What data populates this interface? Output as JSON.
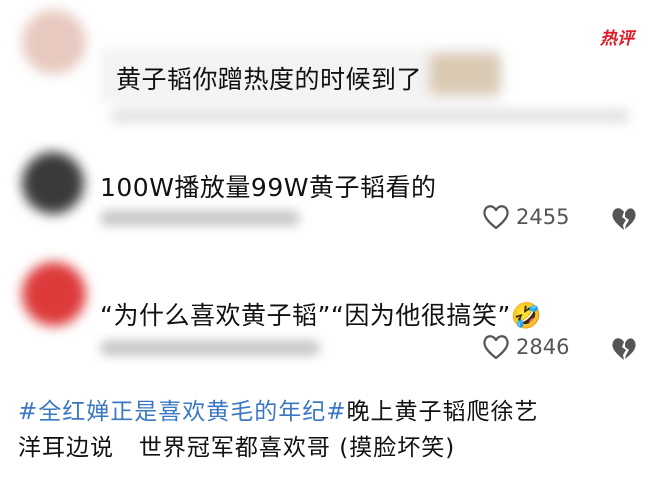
{
  "badge": "热评",
  "comments": [
    {
      "text": "黄子韬你蹭热度的时候到了"
    },
    {
      "text": "100W播放量99W黄子韬看的",
      "likes": "2455"
    },
    {
      "text": "“为什么喜欢黄子韬”“因为他很搞笑”",
      "emoji": "🤣",
      "likes": "2846"
    }
  ],
  "caption": {
    "hashtag": "#全红婵正是喜欢黄毛的年纪#",
    "line1_rest": "晚上黄子韬爬徐艺",
    "line2": "洋耳边说   世界冠军都喜欢哥 (摸脸坏笑)"
  },
  "icons": {
    "like": "heart-outline-icon",
    "dislike": "broken-heart-icon"
  },
  "colors": {
    "hashtag": "#3a78c4",
    "badge": "#e11b2a",
    "text": "#111111",
    "muted": "#555555"
  }
}
